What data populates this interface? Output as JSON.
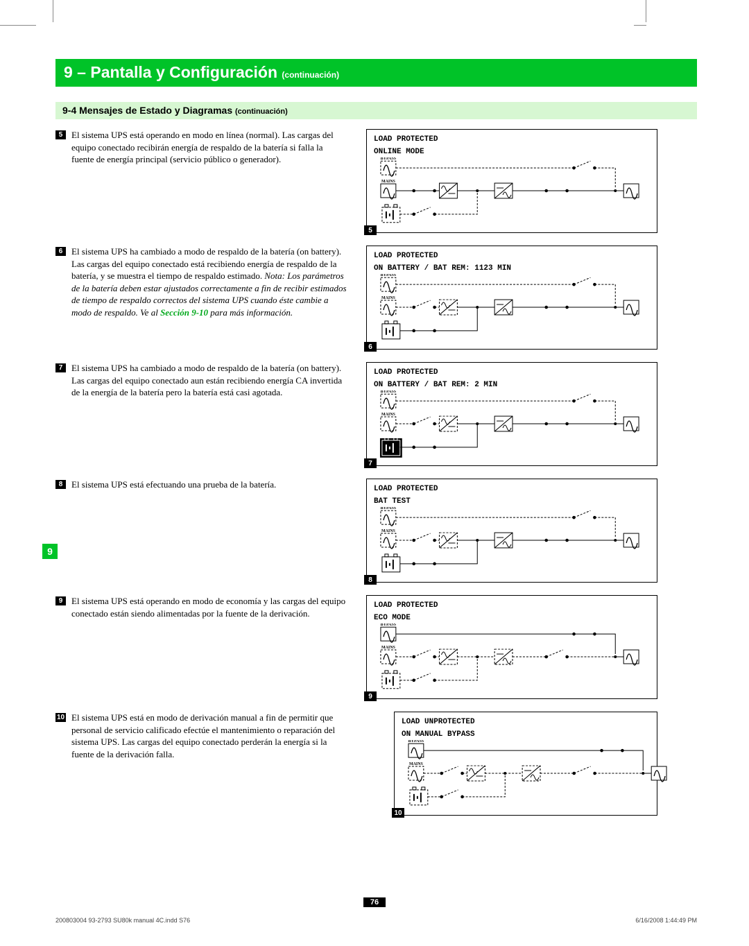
{
  "section": {
    "num": "9",
    "title": "Pantalla y Configuración",
    "cont": "(continuación)"
  },
  "sub": {
    "num": "9-4",
    "title": "Mensajes de Estado y Diagramas",
    "cont": "(continuación)"
  },
  "sideTab": "9",
  "items": [
    {
      "n": "5",
      "text": "El sistema UPS está operando en modo en línea (normal). Las cargas del equipo conectado recibirán energía de respaldo de la batería si falla la fuente de energía principal (servicio público o generador).",
      "lcd": {
        "l1": "LOAD PROTECTED",
        "l2": "ONLINE MODE",
        "type": "online"
      }
    },
    {
      "n": "6",
      "text": "El sistema UPS ha cambiado a modo de respaldo de la batería (on battery). Las cargas del equipo conectado está recibiendo energía de respaldo de la batería, y se muestra el tiempo de respaldo estimado.",
      "noteItalic": "Nota: Los parámetros de la batería deben estar ajustados correctamente a fin de recibir estimados de tiempo de respaldo correctos del sistema UPS cuando éste cambie a modo de respaldo. Ve al ",
      "link": "Sección 9-10",
      "noteAfter": " para más información.",
      "lcd": {
        "l1": "LOAD PROTECTED",
        "l2": "ON BATTERY / BAT REM: 1123 MIN",
        "type": "battery"
      }
    },
    {
      "n": "7",
      "text": "El sistema UPS ha cambiado a modo de respaldo de la batería (on battery). Las cargas del equipo conectado aun están recibiendo energía CA invertida de la energía de la batería pero la batería está casi agotada.",
      "lcd": {
        "l1": "LOAD PROTECTED",
        "l2": "ON BATTERY / BAT REM:   2 MIN",
        "type": "batteryflash"
      }
    },
    {
      "n": "8",
      "text": "El sistema UPS está efectuando una prueba de la batería.",
      "lcd": {
        "l1": "LOAD PROTECTED",
        "l2": "BAT TEST",
        "type": "battest"
      }
    },
    {
      "n": "9",
      "text": "El sistema UPS está operando en modo de economía y las cargas del equipo conectado están siendo alimentadas por la fuente de la derivación.",
      "lcd": {
        "l1": "LOAD PROTECTED",
        "l2": "ECO MODE",
        "type": "eco"
      }
    },
    {
      "n": "10",
      "text": "El sistema UPS está en modo de derivación manual a fin de permitir que personal de servicio calificado efectúe el mantenimiento o reparación del sistema UPS. Las cargas del equipo conectado perderán la energía si la fuente de la derivación falla.",
      "lcd": {
        "l1": "LOAD UNPROTECTED",
        "l2": "ON MANUAL BYPASS",
        "type": "manbypass",
        "indent": true
      }
    }
  ],
  "pageNumber": "76",
  "footerLeft": "200803004 93-2793 SU80k manual 4C.indd   S76",
  "footerRight": "6/16/2008   1:44:49 PM"
}
